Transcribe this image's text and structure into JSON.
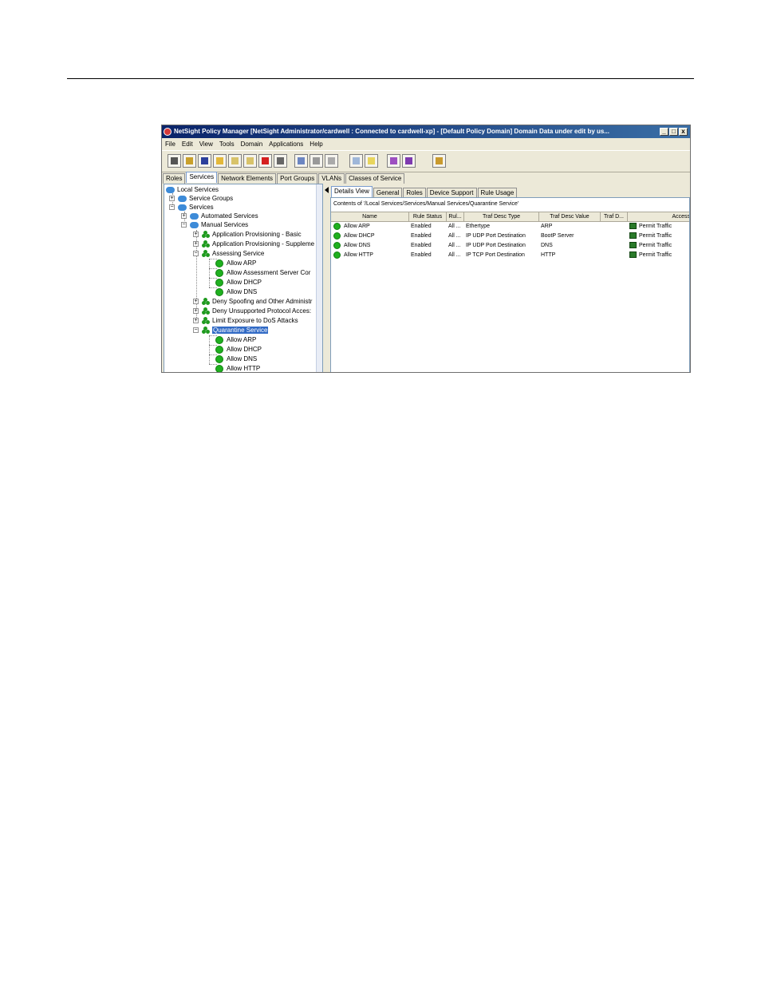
{
  "window": {
    "title": "NetSight Policy Manager [NetSight Administrator/cardwell : Connected to cardwell-xp] - [Default Policy Domain] Domain Data under edit by us...",
    "controls": {
      "minimize": "_",
      "maximize": "□",
      "close": "x"
    }
  },
  "menu": [
    "File",
    "Edit",
    "View",
    "Tools",
    "Domain",
    "Applications",
    "Help"
  ],
  "toolbar_icons": [
    "open-domain-icon",
    "lock-icon",
    "save-icon",
    "folder-icon",
    "import-icon",
    "export-icon",
    "delete-icon",
    "print-icon",
    "copy-icon",
    "paste-icon",
    "undo-icon",
    "refresh-icon",
    "enforce-icon",
    "palette-icon",
    "edit-icon",
    "wizard-icon"
  ],
  "main_tabs": [
    "Roles",
    "Services",
    "Network Elements",
    "Port Groups",
    "VLANs",
    "Classes of Service"
  ],
  "tree": {
    "root": "Local Services",
    "service_groups": "Service Groups",
    "services": "Services",
    "automated": "Automated Services",
    "manual": "Manual Services",
    "app_basic": "Application Provisioning - Basic",
    "app_supp": "Application Provisioning - Suppleme",
    "assessing": "Assessing Service",
    "assessing_rules": [
      "Allow ARP",
      "Allow Assessment Server Cor",
      "Allow DHCP",
      "Allow DNS"
    ],
    "deny_spoofing": "Deny Spoofing and Other Administr",
    "deny_unsupported": "Deny Unsupported Protocol Acces:",
    "limit_dos": "Limit Exposure to DoS Attacks",
    "quarantine": "Quarantine Service",
    "quarantine_rules": [
      "Allow ARP",
      "Allow DHCP",
      "Allow DNS",
      "Allow HTTP"
    ]
  },
  "sub_tabs": [
    "Details View",
    "General",
    "Roles",
    "Device Support",
    "Rule Usage"
  ],
  "contents_label": "Contents of '/Local Services/Services/Manual Services/Quarantine Service'",
  "grid": {
    "columns": [
      "Name",
      "Rule Status",
      "Rul...",
      "Traf Desc Type",
      "Traf Desc Value",
      "Traf D...",
      "Access"
    ],
    "rows": [
      {
        "name": "Allow ARP",
        "status": "Enabled",
        "rul": "All ...",
        "type": "Ethertype",
        "value": "ARP",
        "trafd": "",
        "access": "Permit Traffic"
      },
      {
        "name": "Allow DHCP",
        "status": "Enabled",
        "rul": "All ...",
        "type": "IP UDP Port Destination",
        "value": "BootP Server",
        "trafd": "",
        "access": "Permit Traffic"
      },
      {
        "name": "Allow DNS",
        "status": "Enabled",
        "rul": "All ...",
        "type": "IP UDP Port Destination",
        "value": "DNS",
        "trafd": "",
        "access": "Permit Traffic"
      },
      {
        "name": "Allow HTTP",
        "status": "Enabled",
        "rul": "All ...",
        "type": "IP TCP Port Destination",
        "value": "HTTP",
        "trafd": "",
        "access": "Permit Traffic"
      }
    ]
  },
  "colors": {
    "title_start": "#0a246a",
    "title_end": "#3a6ea5",
    "selection": "#316ac5",
    "rule_green": "#1fb01f",
    "chrome": "#ece9d8"
  }
}
